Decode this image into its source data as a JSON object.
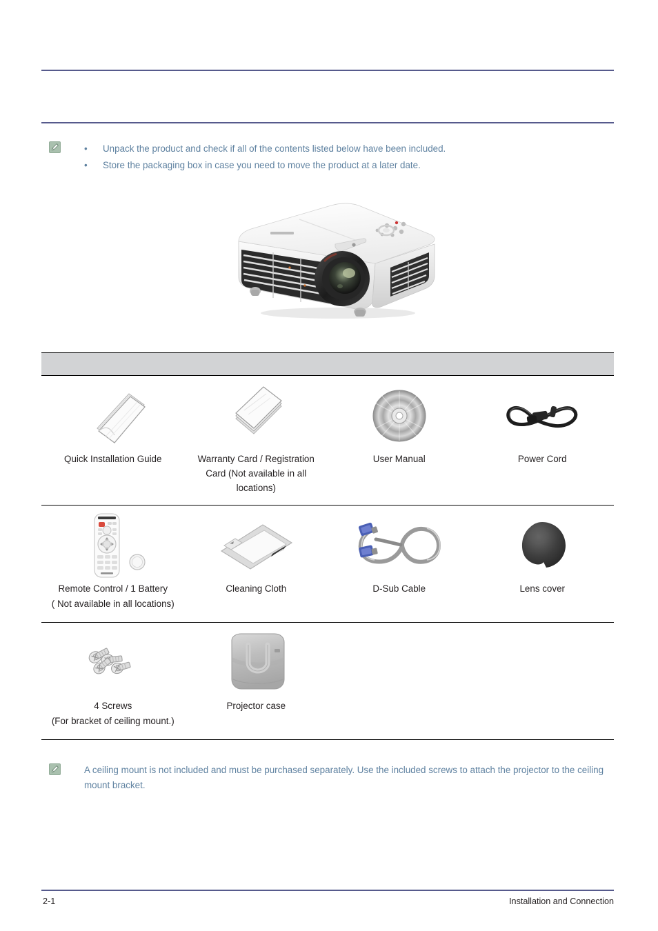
{
  "page": {
    "footer_page_number": "2-1",
    "footer_section": "Installation and Connection",
    "header_title": "",
    "header_chapter": ""
  },
  "colors": {
    "rule": "#565a8c",
    "note_text": "#5e81a0",
    "note_icon_bg": "#a9c0ae",
    "table_header_bg": "#d2d3d5",
    "body_text": "#231f20"
  },
  "note_top": {
    "icon": "note-pencil-icon",
    "bullets": [
      "Unpack the product and check if all of the contents listed below have been included.",
      "Store the packaging box in case you need to move the product at a later date."
    ],
    "bullet_glyph": "•"
  },
  "hero": {
    "alt": "projector-product-image"
  },
  "table": {
    "header_label": "",
    "rows": [
      [
        {
          "icon": "quick-installation-guide-icon",
          "label": "Quick Installation Guide",
          "sub": ""
        },
        {
          "icon": "warranty-card-icon",
          "label": "Warranty Card / Registration Card (Not available in all locations)",
          "sub": ""
        },
        {
          "icon": "user-manual-disc-icon",
          "label": "User Manual",
          "sub": ""
        },
        {
          "icon": "power-cord-icon",
          "label": "Power Cord",
          "sub": ""
        }
      ],
      [
        {
          "icon": "remote-control-icon",
          "label": "Remote Control / 1 Battery",
          "sub": "( Not available in all locations)"
        },
        {
          "icon": "cleaning-cloth-icon",
          "label": "Cleaning Cloth",
          "sub": ""
        },
        {
          "icon": "d-sub-cable-icon",
          "label": "D-Sub Cable",
          "sub": ""
        },
        {
          "icon": "lens-cover-icon",
          "label": "Lens cover",
          "sub": ""
        }
      ],
      [
        {
          "icon": "screws-icon",
          "label": "4 Screws",
          "sub": "(For bracket of ceiling mount.)"
        },
        {
          "icon": "projector-case-icon",
          "label": "Projector case",
          "sub": ""
        },
        {
          "icon": "",
          "label": "",
          "sub": ""
        },
        {
          "icon": "",
          "label": "",
          "sub": ""
        }
      ]
    ]
  },
  "note_bottom": {
    "icon": "note-pencil-icon",
    "text": "A ceiling mount is not included and must be purchased separately. Use the included screws to attach the projector to the ceiling mount bracket."
  }
}
